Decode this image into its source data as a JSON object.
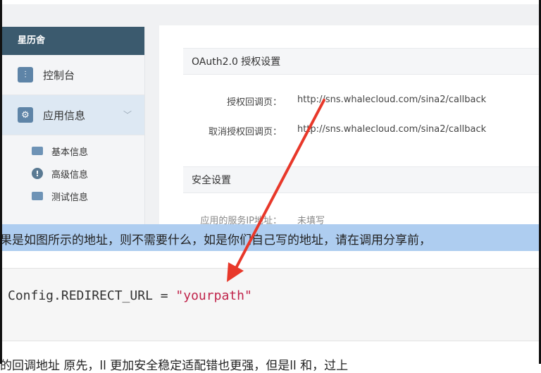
{
  "sidebar": {
    "brand": "星历舍",
    "items": [
      {
        "label": "控制台",
        "icon": "sliders-icon"
      },
      {
        "label": "应用信息",
        "icon": "gear-icon"
      }
    ],
    "sub_items": [
      {
        "label": "基本信息",
        "icon": "card-icon"
      },
      {
        "label": "高级信息",
        "icon": "info-icon"
      },
      {
        "label": "测试信息",
        "icon": "image-icon"
      }
    ]
  },
  "main": {
    "oauth_title": "OAuth2.0 授权设置",
    "auth_callback_label": "授权回调页：",
    "auth_callback_value": "http://sns.whalecloud.com/sina2/callback",
    "cancel_callback_label": "取消授权回调页：",
    "cancel_callback_value": "http://sns.whalecloud.com/sina2/callback",
    "security_title": "安全设置",
    "partial_label": "应用的服务IP地址：",
    "partial_value": "未填写"
  },
  "band_text": "果是如图所示的地址，则不需要什么，如是你们自己写的地址，请在调用分享前，",
  "code": {
    "prefix": "Config.REDIRECT_URL = ",
    "string": "\"yourpath\""
  },
  "bottom_text": "的回调地址 原先，ll 更加安全稳定适配错也更强，但是ll 和，过上",
  "colors": {
    "brand_bg": "#3b5a6e",
    "arrow": "#e8382a",
    "band": "#aecdf0",
    "code_string": "#c0234a"
  }
}
